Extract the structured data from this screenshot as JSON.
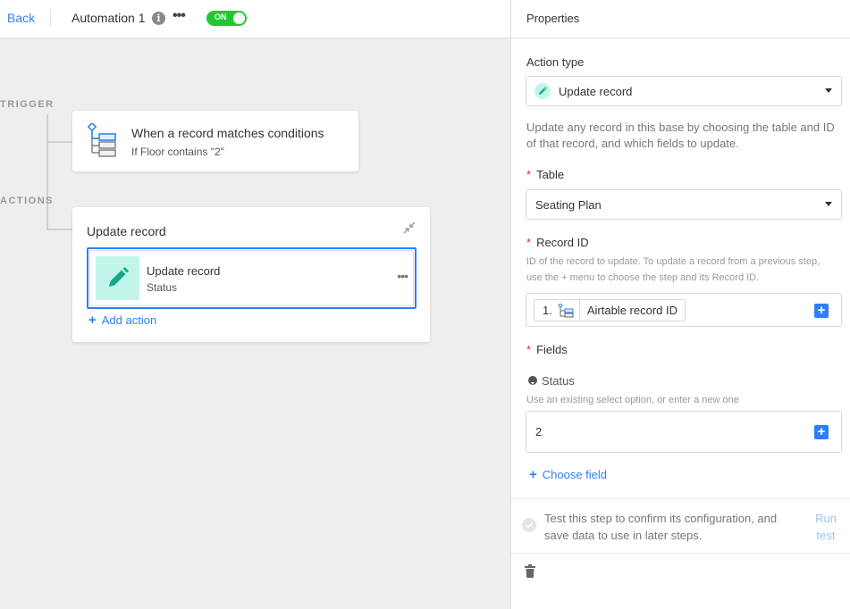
{
  "topbar": {
    "back_label": "Back",
    "automation_name": "Automation 1",
    "toggle_label": "ON",
    "icons": {
      "info": "info-icon",
      "more": "more-icon"
    }
  },
  "canvas": {
    "trigger_label": "TRIGGER",
    "actions_label": "ACTIONS",
    "trigger_card": {
      "title": "When a record matches conditions",
      "subtitle": "If Floor contains \"2\""
    },
    "actions_card": {
      "title": "Update record",
      "item": {
        "title": "Update record",
        "subtitle": "Status"
      },
      "add_action_label": "Add action"
    }
  },
  "panel": {
    "title": "Properties",
    "action_type": {
      "label": "Action type",
      "value": "Update record"
    },
    "description": "Update any record in this base by choosing the table and ID of that record, and which fields to update.",
    "table": {
      "label": "Table",
      "value": "Seating Plan"
    },
    "record_id": {
      "label": "Record ID",
      "hint": "ID of the record to update. To update a record from a previous step, use the + menu to choose the step and its Record ID.",
      "step_number": "1.",
      "value": "Airtable record ID"
    },
    "fields": {
      "label": "Fields",
      "field_name": "Status",
      "hint": "Use an existing select option, or enter a new one",
      "value": "2"
    },
    "choose_field_label": "Choose field",
    "test": {
      "text": "Test this step to confirm its configuration, and save data to use in later steps.",
      "run_label": "Run test"
    }
  },
  "colors": {
    "accent": "#2d7ff9",
    "toggle_on": "#20c933",
    "action_icon_bg": "#c2f5e9",
    "action_icon_fg": "#11a88a",
    "required": "#e0245e"
  }
}
